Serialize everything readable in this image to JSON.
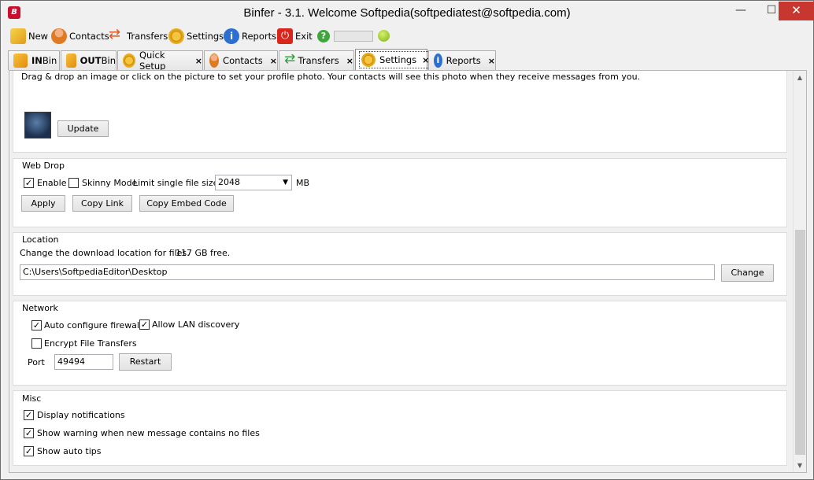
{
  "window": {
    "title": "Binfer - 3.1. Welcome Softpedia(softpediatest@softpedia.com)",
    "app_icon_letter": "B",
    "minimize": "—",
    "maximize": "☐",
    "close": "✕"
  },
  "toolbar": {
    "new": "New",
    "contacts": "Contacts",
    "transfers": "Transfers",
    "settings": "Settings",
    "reports": "Reports",
    "exit": "Exit",
    "help_glyph": "?",
    "reports_glyph": "i",
    "exit_glyph": "⏻"
  },
  "tabs": [
    {
      "label_bold": "IN",
      "label": " Bin",
      "closable": false
    },
    {
      "label_bold": "OUT",
      "label": " Bin",
      "closable": false
    },
    {
      "label": "Quick Setup",
      "closable": true
    },
    {
      "label": "Contacts",
      "closable": true
    },
    {
      "label": "Transfers",
      "closable": true
    },
    {
      "label": "Settings",
      "closable": true,
      "active": true
    },
    {
      "label": "Reports",
      "closable": true
    }
  ],
  "tab_close_glyph": "×",
  "profile": {
    "instructions": "Drag & drop an image or click on the picture to set your profile photo. Your contacts will see this photo when they receive messages from you.",
    "update_button": "Update"
  },
  "webdrop": {
    "title": "Web Drop",
    "enable_label": "Enable",
    "enable_checked": true,
    "skinny_label": "Skinny Mode",
    "skinny_checked": false,
    "limit_label": "Limit single file size to",
    "limit_value": "2048",
    "limit_unit": "MB",
    "apply_button": "Apply",
    "copy_link_button": "Copy Link",
    "copy_embed_button": "Copy Embed Code"
  },
  "location": {
    "title": "Location",
    "description": "Change the download location for files.",
    "free_space": "117 GB free.",
    "path": "C:\\Users\\SoftpediaEditor\\Desktop",
    "change_button": "Change"
  },
  "network": {
    "title": "Network",
    "auto_firewall_label": "Auto configure firewall",
    "auto_firewall_checked": true,
    "lan_discovery_label": "Allow LAN discovery",
    "lan_discovery_checked": true,
    "encrypt_label": "Encrypt File Transfers",
    "encrypt_checked": false,
    "port_label": "Port",
    "port_value": "49494",
    "restart_button": "Restart"
  },
  "misc": {
    "title": "Misc",
    "notifications_label": "Display notifications",
    "notifications_checked": true,
    "warning_label": "Show warning when new message contains no files",
    "warning_checked": true,
    "tips_label": "Show auto tips",
    "tips_checked": true
  },
  "scrollbar": {
    "up_glyph": "▲",
    "down_glyph": "▼"
  }
}
